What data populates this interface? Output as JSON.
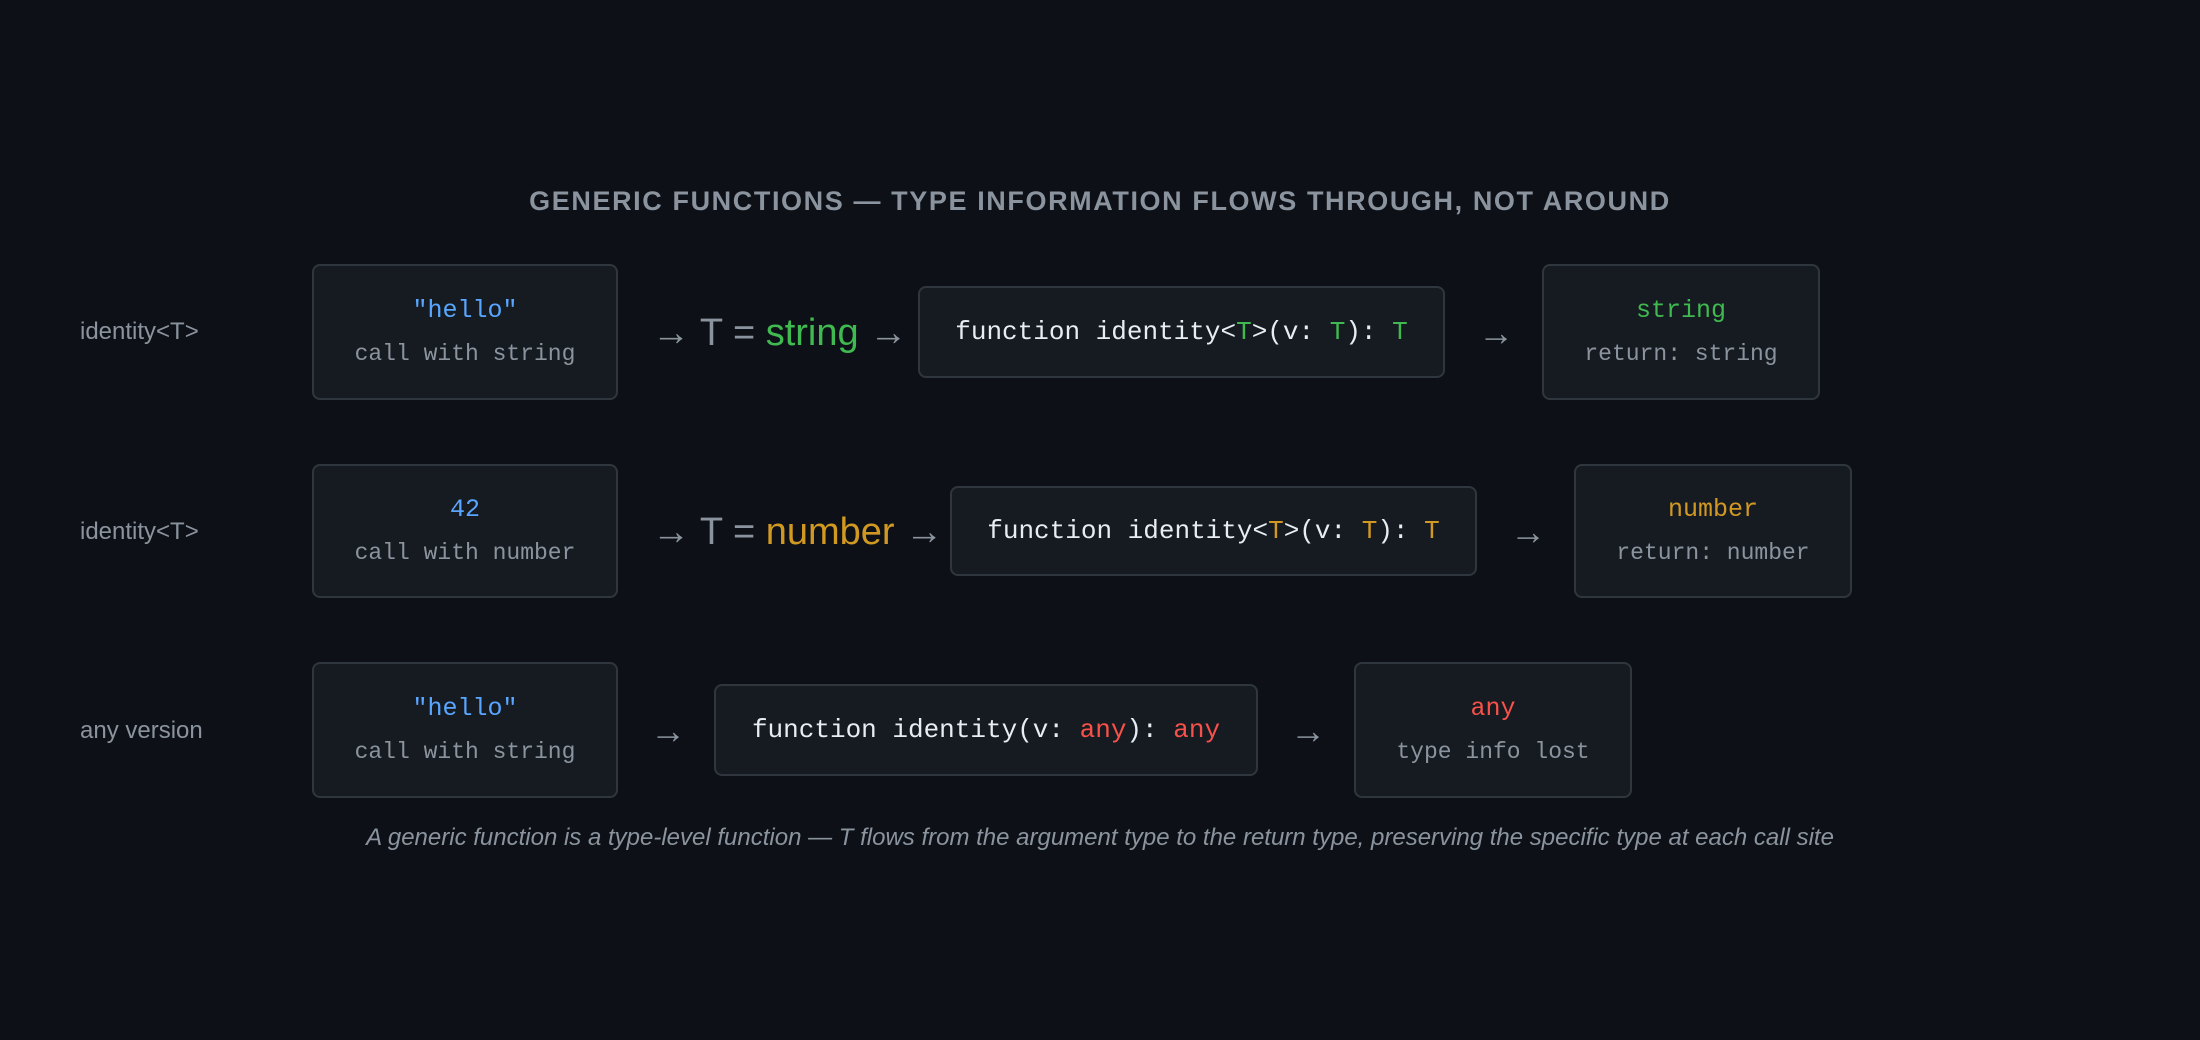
{
  "title": "GENERIC FUNCTIONS — TYPE INFORMATION FLOWS THROUGH, NOT AROUND",
  "rows": [
    {
      "label": "identity<T>",
      "input": {
        "value": "\"hello\"",
        "desc": "call with string"
      },
      "flow": {
        "arrow": "→",
        "prefix": "T = ",
        "type": "string"
      },
      "function": {
        "pre": "function identity<",
        "t1": "T",
        "mid": ">(v: ",
        "t2": "T",
        "post": "): ",
        "t3": "T"
      },
      "output": {
        "value": "string",
        "desc": "return: string"
      }
    },
    {
      "label": "identity<T>",
      "input": {
        "value": "42",
        "desc": "call with number"
      },
      "flow": {
        "arrow": "→",
        "prefix": "T = ",
        "type": "number"
      },
      "function": {
        "pre": "function identity<",
        "t1": "T",
        "mid": ">(v: ",
        "t2": "T",
        "post": "): ",
        "t3": "T"
      },
      "output": {
        "value": "number",
        "desc": "return: number"
      }
    },
    {
      "label": "any version",
      "input": {
        "value": "\"hello\"",
        "desc": "call with string"
      },
      "function": {
        "pre": "function identity(v: ",
        "t1": "any",
        "post": "): ",
        "t2": "any"
      },
      "output": {
        "value": "any",
        "desc": "type info lost"
      }
    }
  ],
  "arrow": "→",
  "caption": "A generic function is a type-level function — T flows from the argument type to the return type, preserving the specific type at each call site",
  "colors": {
    "background": "#0d1117",
    "box": "#161b22",
    "border": "#30363d",
    "literal": "#58a6ff",
    "string_type": "#3fb950",
    "number_type": "#d29922",
    "any_type": "#f85149"
  }
}
